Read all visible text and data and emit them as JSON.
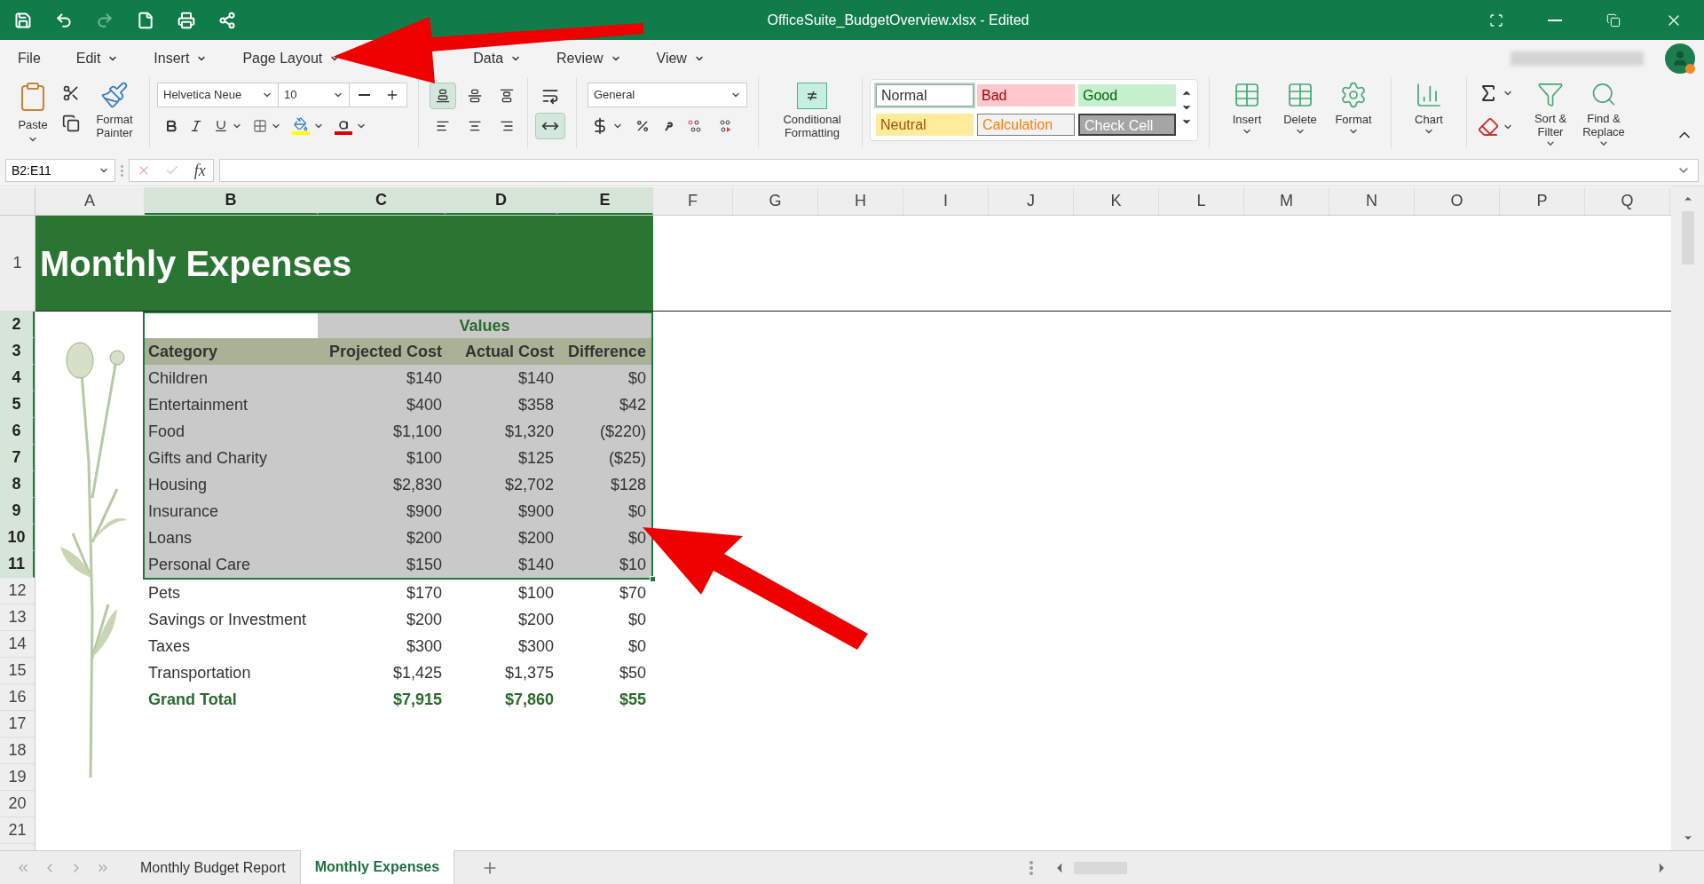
{
  "window": {
    "title": "OfficeSuite_BudgetOverview.xlsx - Edited",
    "quick_access": [
      {
        "kind": "save",
        "disabled": false
      },
      {
        "kind": "undo",
        "disabled": false
      },
      {
        "kind": "redo",
        "disabled": true
      },
      {
        "kind": "new",
        "disabled": false
      },
      {
        "kind": "print",
        "disabled": false
      },
      {
        "kind": "share",
        "disabled": false
      }
    ]
  },
  "menu": [
    {
      "label": "File",
      "dropdown": false
    },
    {
      "label": "Edit",
      "dropdown": true
    },
    {
      "label": "Insert",
      "dropdown": true
    },
    {
      "label": "Page Layout",
      "dropdown": true
    },
    {
      "label": "Data",
      "dropdown": true
    },
    {
      "label": "Review",
      "dropdown": true
    },
    {
      "label": "View",
      "dropdown": true
    }
  ],
  "ribbon": {
    "paste": "Paste",
    "format_painter": "Format Painter",
    "font": "Helvetica Neue",
    "font_size": "10",
    "vertical_align": [
      {
        "selected": true
      },
      {
        "selected": false
      },
      {
        "selected": false
      }
    ],
    "horizontal_align": [
      {
        "selected": false
      },
      {
        "selected": false
      },
      {
        "selected": false
      }
    ],
    "wrap_text": {
      "selected": false
    },
    "merge": {
      "selected": true
    },
    "number_format": "General",
    "conditional_formatting": "Conditional Formatting",
    "styles": [
      {
        "label": "Normal",
        "kind": "normal",
        "selected": true
      },
      {
        "label": "Bad",
        "kind": "bad",
        "selected": false
      },
      {
        "label": "Good",
        "kind": "good",
        "selected": false
      },
      {
        "label": "Neutral",
        "kind": "neutral",
        "selected": false
      },
      {
        "label": "Calculation",
        "kind": "calculation",
        "selected": false
      },
      {
        "label": "Check Cell",
        "kind": "check",
        "selected": false
      }
    ],
    "cells": [
      "Insert",
      "Delete",
      "Format"
    ],
    "chart": "Chart",
    "sort_filter": "Sort & Filter",
    "find_replace": "Find & Replace"
  },
  "formula_bar": {
    "name_box": "B2:E11",
    "fx": "fx"
  },
  "columns": [
    {
      "label": "A",
      "selected": false
    },
    {
      "label": "B",
      "selected": true
    },
    {
      "label": "C",
      "selected": true
    },
    {
      "label": "D",
      "selected": true
    },
    {
      "label": "E",
      "selected": true
    },
    {
      "label": "F",
      "selected": false
    },
    {
      "label": "G",
      "selected": false
    },
    {
      "label": "H",
      "selected": false
    },
    {
      "label": "I",
      "selected": false
    },
    {
      "label": "J",
      "selected": false
    },
    {
      "label": "K",
      "selected": false
    },
    {
      "label": "L",
      "selected": false
    },
    {
      "label": "M",
      "selected": false
    },
    {
      "label": "N",
      "selected": false
    },
    {
      "label": "O",
      "selected": false
    },
    {
      "label": "P",
      "selected": false
    },
    {
      "label": "Q",
      "selected": false
    }
  ],
  "row_headers": [
    {
      "label": "1",
      "selected": false
    },
    {
      "label": "2",
      "selected": true
    },
    {
      "label": "3",
      "selected": true
    },
    {
      "label": "4",
      "selected": true
    },
    {
      "label": "5",
      "selected": true
    },
    {
      "label": "6",
      "selected": true
    },
    {
      "label": "7",
      "selected": true
    },
    {
      "label": "8",
      "selected": true
    },
    {
      "label": "9",
      "selected": true
    },
    {
      "label": "10",
      "selected": true
    },
    {
      "label": "11",
      "selected": true
    },
    {
      "label": "12",
      "selected": false
    },
    {
      "label": "13",
      "selected": false
    },
    {
      "label": "14",
      "selected": false
    },
    {
      "label": "15",
      "selected": false
    },
    {
      "label": "16",
      "selected": false
    },
    {
      "label": "17",
      "selected": false
    },
    {
      "label": "18",
      "selected": false
    },
    {
      "label": "19",
      "selected": false
    },
    {
      "label": "20",
      "selected": false
    },
    {
      "label": "21",
      "selected": false
    }
  ],
  "sheet": {
    "title": "Monthly Expenses",
    "values_header": "Values",
    "headers": [
      "Category",
      "Projected Cost",
      "Actual Cost",
      "Difference"
    ],
    "rows": [
      {
        "cells": [
          "Children",
          "$140",
          "$140",
          "$0"
        ],
        "selected": true
      },
      {
        "cells": [
          "Entertainment",
          "$400",
          "$358",
          "$42"
        ],
        "selected": true
      },
      {
        "cells": [
          "Food",
          "$1,100",
          "$1,320",
          "($220)"
        ],
        "selected": true
      },
      {
        "cells": [
          "Gifts and Charity",
          "$100",
          "$125",
          "($25)"
        ],
        "selected": true
      },
      {
        "cells": [
          "Housing",
          "$2,830",
          "$2,702",
          "$128"
        ],
        "selected": true
      },
      {
        "cells": [
          "Insurance",
          "$900",
          "$900",
          "$0"
        ],
        "selected": true
      },
      {
        "cells": [
          "Loans",
          "$200",
          "$200",
          "$0"
        ],
        "selected": true
      },
      {
        "cells": [
          "Personal Care",
          "$150",
          "$140",
          "$10"
        ],
        "selected": true
      },
      {
        "cells": [
          "Pets",
          "$170",
          "$100",
          "$70"
        ],
        "selected": false
      },
      {
        "cells": [
          "Savings or Investment",
          "$200",
          "$200",
          "$0"
        ],
        "selected": false
      },
      {
        "cells": [
          "Taxes",
          "$300",
          "$300",
          "$0"
        ],
        "selected": false
      },
      {
        "cells": [
          "Transportation",
          "$1,425",
          "$1,375",
          "$50"
        ],
        "selected": false
      }
    ],
    "total": [
      "Grand Total",
      "$7,915",
      "$7,860",
      "$55"
    ]
  },
  "sheet_tabs": [
    {
      "label": "Monthly Budget Report",
      "selected": false
    },
    {
      "label": "Monthly Expenses",
      "selected": true
    }
  ]
}
